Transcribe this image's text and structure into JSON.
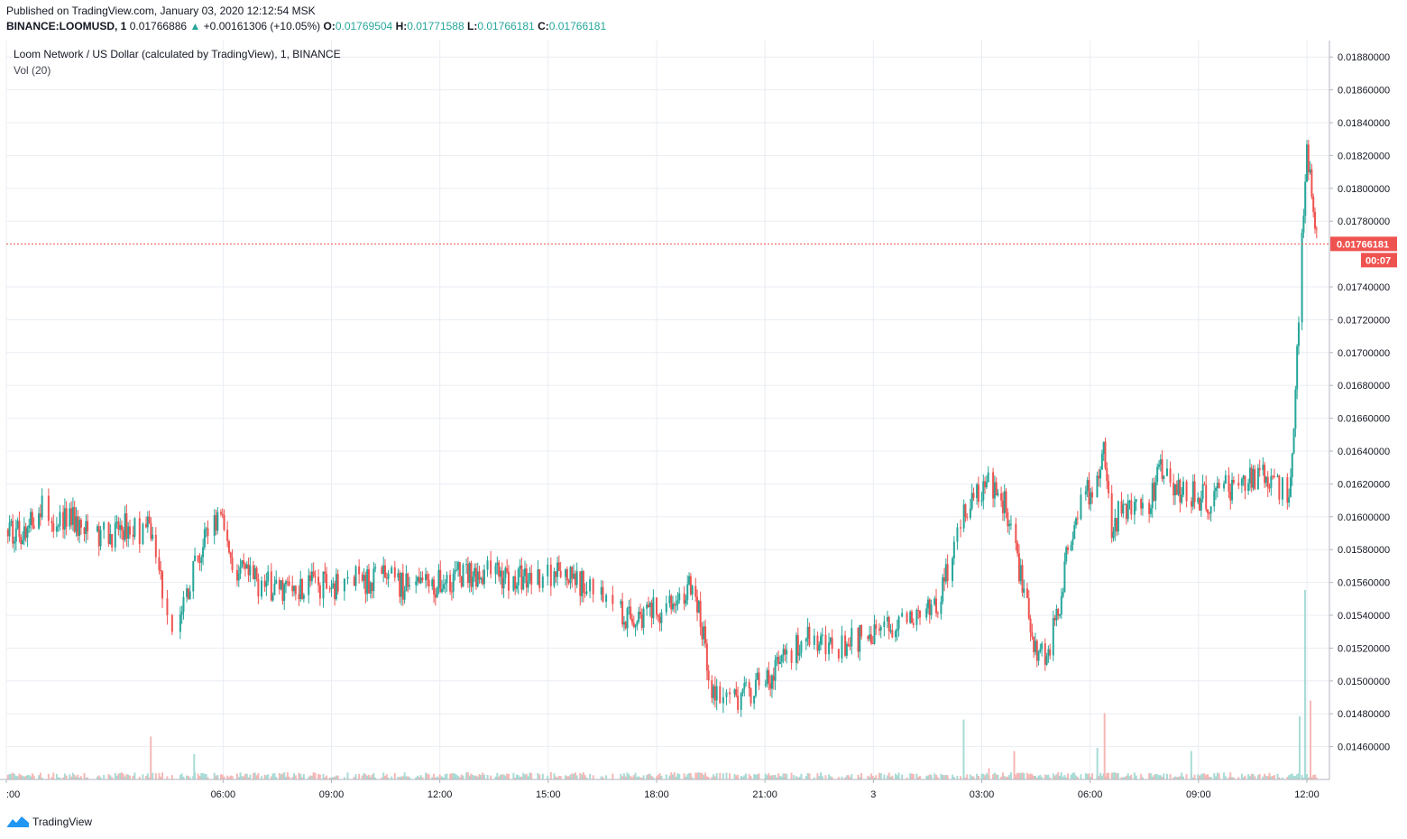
{
  "header": {
    "published": "Published on TradingView.com, January 03, 2020 12:12:54 MSK",
    "symbol": "BINANCE:LOOMUSD, 1",
    "last": "0.01766886",
    "change_arrow": "▲",
    "change": "+0.00161306 (+10.05%)",
    "o_label": "O:",
    "o_value": "0.01769504",
    "h_label": "H:",
    "h_value": "0.01771588",
    "l_label": "L:",
    "l_value": "0.01766181",
    "c_label": "C:",
    "c_value": "0.01766181"
  },
  "legend": {
    "title": "Loom Network / US Dollar (calculated by TradingView), 1, BINANCE",
    "volume": "Vol (20)"
  },
  "footer": {
    "brand": "TradingView",
    "logo_icon": "tradingview-logo-icon"
  },
  "colors": {
    "up": "#26a69a",
    "down": "#ef5350",
    "grid": "#e9edf3",
    "axis_text": "#131722",
    "price_line": "#ef5350",
    "volume_up": "#a8dcd6",
    "volume_down": "#f5b8b6"
  },
  "chart_data": {
    "type": "candlestick",
    "title": "Loom Network / US Dollar (calculated by TradingView), 1, BINANCE",
    "interval": "1 minute",
    "grid": true,
    "ylim": [
      0.0144,
      0.0189
    ],
    "y_ticks": [
      0.0188,
      0.0186,
      0.0184,
      0.0182,
      0.018,
      0.0178,
      0.0174,
      0.0172,
      0.017,
      0.0168,
      0.0166,
      0.0164,
      0.0162,
      0.016,
      0.0158,
      0.0156,
      0.0154,
      0.0152,
      0.015,
      0.0148,
      0.0146
    ],
    "y_tick_labels": [
      "0.01880000",
      "0.01860000",
      "0.01840000",
      "0.01820000",
      "0.01800000",
      "0.01780000",
      "0.01740000",
      "0.01720000",
      "0.01700000",
      "0.01680000",
      "0.01660000",
      "0.01640000",
      "0.01620000",
      "0.01600000",
      "0.01580000",
      "0.01560000",
      "0.01540000",
      "0.01520000",
      "0.01500000",
      "0.01480000",
      "0.01460000"
    ],
    "x_ticks": [
      {
        "hours": 0,
        "label": ":00"
      },
      {
        "hours": 6,
        "label": "06:00"
      },
      {
        "hours": 9,
        "label": "09:00"
      },
      {
        "hours": 12,
        "label": "12:00"
      },
      {
        "hours": 15,
        "label": "15:00"
      },
      {
        "hours": 18,
        "label": "18:00"
      },
      {
        "hours": 21,
        "label": "21:00"
      },
      {
        "hours": 24,
        "label": "3"
      },
      {
        "hours": 27,
        "label": "03:00"
      },
      {
        "hours": 30,
        "label": "06:00"
      },
      {
        "hours": 33,
        "label": "09:00"
      },
      {
        "hours": 36,
        "label": "12:00"
      }
    ],
    "x_range_hours": [
      0,
      36.3
    ],
    "current_price": 0.01766181,
    "current_price_label": "0.01766181",
    "countdown_label": "00:07",
    "price_path": [
      [
        0.0,
        0.01592
      ],
      [
        0.6,
        0.01591
      ],
      [
        0.9,
        0.01607
      ],
      [
        1.3,
        0.016
      ],
      [
        1.8,
        0.01598
      ],
      [
        2.2,
        0.0159
      ],
      [
        2.5,
        0.01586
      ],
      [
        2.9,
        0.0159
      ],
      [
        3.3,
        0.01594
      ],
      [
        3.6,
        0.01592
      ],
      [
        4.0,
        0.01592
      ],
      [
        4.3,
        0.0156
      ],
      [
        4.5,
        0.01524
      ],
      [
        4.8,
        0.0154
      ],
      [
        5.2,
        0.01568
      ],
      [
        5.6,
        0.0159
      ],
      [
        5.9,
        0.016
      ],
      [
        6.1,
        0.01584
      ],
      [
        6.4,
        0.01566
      ],
      [
        6.9,
        0.0156
      ],
      [
        7.6,
        0.01556
      ],
      [
        8.4,
        0.0156
      ],
      [
        9.1,
        0.01558
      ],
      [
        9.8,
        0.01562
      ],
      [
        10.5,
        0.01562
      ],
      [
        11.2,
        0.01556
      ],
      [
        11.9,
        0.01558
      ],
      [
        12.4,
        0.01564
      ],
      [
        13.0,
        0.01566
      ],
      [
        13.5,
        0.01566
      ],
      [
        14.0,
        0.01562
      ],
      [
        14.6,
        0.01564
      ],
      [
        15.1,
        0.01566
      ],
      [
        15.7,
        0.0156
      ],
      [
        16.3,
        0.01558
      ],
      [
        16.8,
        0.01546
      ],
      [
        17.3,
        0.01538
      ],
      [
        17.9,
        0.01542
      ],
      [
        18.4,
        0.01546
      ],
      [
        18.9,
        0.01556
      ],
      [
        19.2,
        0.0154
      ],
      [
        19.5,
        0.015
      ],
      [
        19.8,
        0.01486
      ],
      [
        20.2,
        0.01488
      ],
      [
        20.6,
        0.01494
      ],
      [
        21.0,
        0.015
      ],
      [
        21.6,
        0.01514
      ],
      [
        22.1,
        0.01526
      ],
      [
        22.6,
        0.0152
      ],
      [
        23.1,
        0.01522
      ],
      [
        23.7,
        0.01526
      ],
      [
        24.3,
        0.0153
      ],
      [
        24.8,
        0.01536
      ],
      [
        25.3,
        0.01542
      ],
      [
        25.8,
        0.01548
      ],
      [
        26.2,
        0.0158
      ],
      [
        26.5,
        0.01604
      ],
      [
        26.9,
        0.01614
      ],
      [
        27.3,
        0.0162
      ],
      [
        27.6,
        0.0161
      ],
      [
        27.9,
        0.01584
      ],
      [
        28.2,
        0.01552
      ],
      [
        28.5,
        0.0152
      ],
      [
        28.8,
        0.01516
      ],
      [
        29.1,
        0.0154
      ],
      [
        29.4,
        0.01584
      ],
      [
        29.7,
        0.0161
      ],
      [
        30.1,
        0.01618
      ],
      [
        30.4,
        0.0164
      ],
      [
        30.6,
        0.01596
      ],
      [
        30.9,
        0.01604
      ],
      [
        31.3,
        0.01612
      ],
      [
        31.6,
        0.01604
      ],
      [
        31.9,
        0.0163
      ],
      [
        32.2,
        0.0162
      ],
      [
        32.6,
        0.01614
      ],
      [
        33.0,
        0.01612
      ],
      [
        33.4,
        0.0161
      ],
      [
        33.8,
        0.01618
      ],
      [
        34.3,
        0.01622
      ],
      [
        34.8,
        0.01624
      ],
      [
        35.2,
        0.01618
      ],
      [
        35.5,
        0.01616
      ],
      [
        35.7,
        0.0168
      ],
      [
        35.85,
        0.0176
      ],
      [
        36.0,
        0.0182
      ],
      [
        36.1,
        0.0181
      ],
      [
        36.2,
        0.0179
      ],
      [
        36.3,
        0.01766
      ]
    ],
    "volume_spikes": [
      {
        "hours": 4.0,
        "rel": 0.68,
        "up": false
      },
      {
        "hours": 5.2,
        "rel": 0.4,
        "up": true
      },
      {
        "hours": 12.0,
        "rel": 0.08,
        "up": false
      },
      {
        "hours": 21.8,
        "rel": 0.07,
        "up": true
      },
      {
        "hours": 27.2,
        "rel": 0.18,
        "up": false
      },
      {
        "hours": 26.5,
        "rel": 0.95,
        "up": true
      },
      {
        "hours": 27.9,
        "rel": 0.45,
        "up": false
      },
      {
        "hours": 30.2,
        "rel": 0.5,
        "up": true
      },
      {
        "hours": 30.4,
        "rel": 1.05,
        "up": false
      },
      {
        "hours": 32.8,
        "rel": 0.45,
        "up": true
      },
      {
        "hours": 35.8,
        "rel": 1.0,
        "up": true
      },
      {
        "hours": 35.95,
        "rel": 3.0,
        "up": true
      },
      {
        "hours": 36.1,
        "rel": 1.25,
        "up": false
      }
    ]
  }
}
